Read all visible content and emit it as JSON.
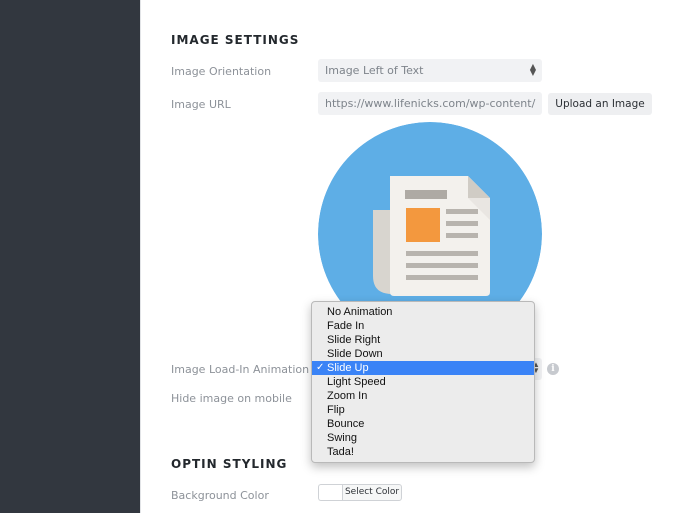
{
  "image_settings": {
    "title": "IMAGE SETTINGS",
    "orientation": {
      "label": "Image Orientation",
      "value": "Image Left of Text"
    },
    "url": {
      "label": "Image URL",
      "value": "https://www.lifenicks.com/wp-content/",
      "button": "Upload an Image"
    },
    "animation": {
      "label": "Image Load-In Animation",
      "options": [
        "No Animation",
        "Fade In",
        "Slide Right",
        "Slide Down",
        "Slide Up",
        "Light Speed",
        "Zoom In",
        "Flip",
        "Bounce",
        "Swing",
        "Tada!"
      ],
      "selected": "Slide Up",
      "check": "✓"
    },
    "hide_mobile": {
      "label": "Hide image on mobile"
    }
  },
  "optin_styling": {
    "title": "OPTIN STYLING",
    "background_color": {
      "label": "Background Color",
      "button": "Select Color"
    }
  },
  "colors": {
    "sidebar": "#32373f",
    "preview_circle": "#5eaee6",
    "selected_option": "#3a83f6"
  }
}
